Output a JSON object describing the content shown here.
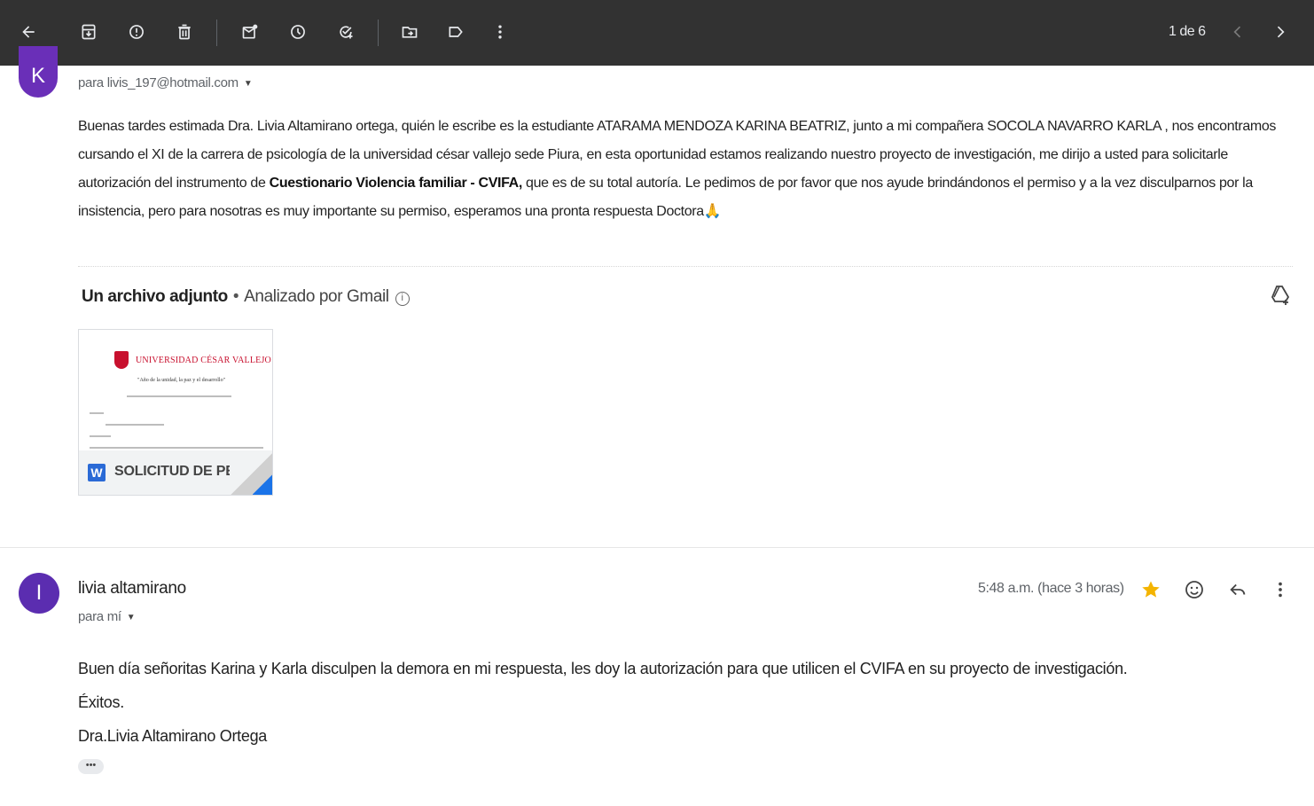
{
  "toolbar": {
    "pager_text": "1 de 6",
    "icons": [
      "back-arrow-icon",
      "archive-icon",
      "report-spam-icon",
      "delete-icon",
      "mark-unread-icon",
      "snooze-icon",
      "add-task-icon",
      "move-to-icon",
      "label-icon",
      "more-vert-icon",
      "newer-icon",
      "older-icon"
    ]
  },
  "first_message": {
    "avatar_letter": "K",
    "avatar_color": "#6a2fb8",
    "recipient": "para livis_197@hotmail.com",
    "body_1": "Buenas tardes estimada Dra. Livia Altamirano ortega, quién le escribe es la estudiante ATARAMA MENDOZA KARINA BEATRIZ, junto a mi compañera  SOCOLA NAVARRO KARLA  , nos encontramos cursando el XI de la carrera de psicología de la universidad césar vallejo sede Piura, en esta oportunidad estamos realizando nuestro proyecto de investigación, me dirijo a usted para solicitarle autorización del instrumento de ",
    "body_bold": "Cuestionario Violencia familiar - CVIFA,",
    "body_2": " que es de su total autoría. Le pedimos de por favor que nos ayude  brindándonos el permiso y a la vez disculparnos por la insistencia, pero para nosotras es muy importante su permiso, esperamos una pronta respuesta Doctora",
    "body_emoji": "🙏"
  },
  "attachments": {
    "title": "Un archivo adjunto",
    "dot": "•",
    "scanned": "Analizado por Gmail",
    "info_symbol": "i",
    "file": {
      "type_letter": "W",
      "name": "SOLICITUD DE PE...",
      "preview_university": "UNIVERSIDAD CÉSAR VALLEJO",
      "preview_motto": "\"Año de la unidad, la paz y el desarrollo\""
    }
  },
  "reply": {
    "avatar_letter": "I",
    "avatar_color": "#5b2db0",
    "sender": "livia altamirano",
    "recipient": "para mí",
    "time": "5:48 a.m. (hace 3 horas)",
    "line_1": "Buen día señoritas Karina y Karla disculpen la demora en mi respuesta, les doy la autorización para que utilicen el CVIFA en su proyecto de investigación.",
    "line_2": "Éxitos.",
    "line_3": "Dra.Livia Altamirano Ortega",
    "more_label": "•••",
    "star_color": "#f4b400"
  }
}
